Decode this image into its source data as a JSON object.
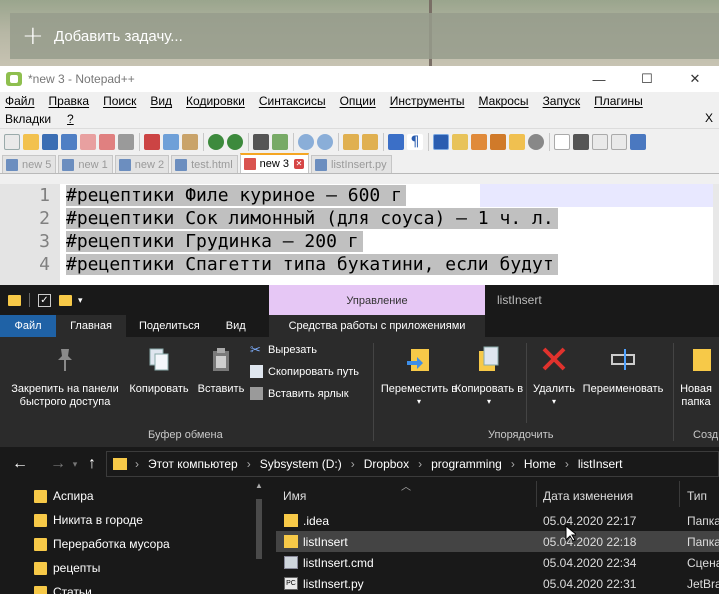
{
  "task_bar": {
    "add_task_label": "Добавить задачу..."
  },
  "npp": {
    "title": "*new 3 - Notepad++",
    "window_controls": {
      "minimize": "—",
      "maximize": "☐",
      "close": "✕"
    },
    "menu": [
      "Файл",
      "Правка",
      "Поиск",
      "Вид",
      "Кодировки",
      "Синтаксисы",
      "Опции",
      "Инструменты",
      "Макросы",
      "Запуск",
      "Плагины"
    ],
    "menu2": [
      "Вкладки",
      "?"
    ],
    "menu2_close": "X",
    "tabs": [
      {
        "label": "new 5",
        "active": false
      },
      {
        "label": "new 1",
        "active": false
      },
      {
        "label": "new 2",
        "active": false
      },
      {
        "label": "test.html",
        "active": false
      },
      {
        "label": "new 3",
        "active": true
      },
      {
        "label": "listInsert.py",
        "active": false
      }
    ],
    "lines": [
      {
        "num": "1",
        "text": "#рецептики Филе куриное — 600 г"
      },
      {
        "num": "2",
        "text": "#рецептики Сок лимонный (для соуса) — 1 ч. л."
      },
      {
        "num": "3",
        "text": "#рецептики Грудинка — 200 г"
      },
      {
        "num": "4",
        "text": "#рецептики Спагетти типа букатини, если будут"
      }
    ]
  },
  "explorer": {
    "manage_tab": "Управление",
    "window_title": "listInsert",
    "ribbon_tabs": {
      "file": "Файл",
      "home": "Главная",
      "share": "Поделиться",
      "view": "Вид",
      "tools": "Средства работы с приложениями"
    },
    "buttons": {
      "pin": "Закрепить на панели быстрого доступа",
      "copy": "Копировать",
      "paste": "Вставить",
      "cut": "Вырезать",
      "copy_path": "Скопировать путь",
      "paste_shortcut": "Вставить ярлык",
      "move_to": "Переместить в",
      "copy_to": "Копировать в",
      "delete": "Удалить",
      "rename": "Переименовать",
      "new_folder": "Новая папка"
    },
    "groups": {
      "clipboard": "Буфер обмена",
      "organize": "Упорядочить",
      "create": "Созд"
    },
    "breadcrumb": [
      "Этот компьютер",
      "Sybsystem (D:)",
      "Dropbox",
      "programming",
      "Home",
      "listInsert"
    ],
    "nav_items": [
      "Аспира",
      "Никита в городе",
      "Переработка мусора",
      "рецепты",
      "Статьи"
    ],
    "columns": {
      "name": "Имя",
      "date": "Дата изменения",
      "type": "Тип"
    },
    "files": [
      {
        "name": ".idea",
        "date": "05.04.2020 22:17",
        "type": "Папка",
        "kind": "folder",
        "selected": false
      },
      {
        "name": "listInsert",
        "date": "05.04.2020 22:18",
        "type": "Папка",
        "kind": "folder",
        "selected": true
      },
      {
        "name": "listInsert.cmd",
        "date": "05.04.2020 22:34",
        "type": "Сцена",
        "kind": "cmd",
        "selected": false
      },
      {
        "name": "listInsert.py",
        "date": "05.04.2020 22:31",
        "type": "JetBra",
        "kind": "py",
        "selected": false
      }
    ]
  },
  "colors": {
    "accent_file_tab": "#1f62a6",
    "manage_tab": "#e6c7f5",
    "folder": "#f7c948",
    "npp_active_tab": "#f5a623"
  }
}
